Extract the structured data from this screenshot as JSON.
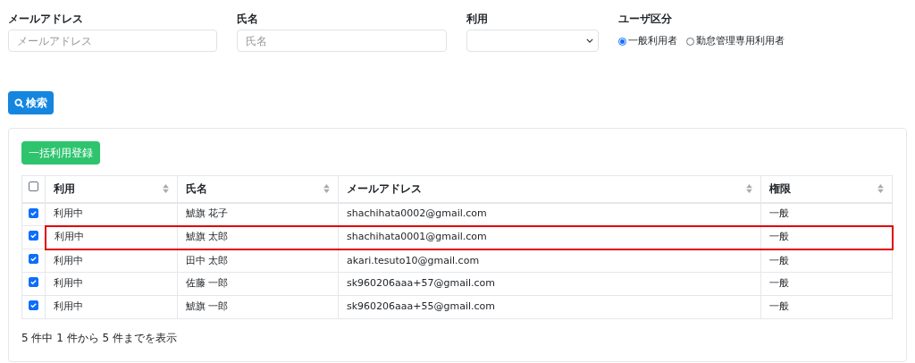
{
  "filters": {
    "email": {
      "label": "メールアドレス",
      "placeholder": "メールアドレス"
    },
    "name": {
      "label": "氏名",
      "placeholder": "氏名"
    },
    "usage": {
      "label": "利用"
    },
    "user_type": {
      "label": "ユーザ区分",
      "options": [
        {
          "label": "一般利用者",
          "selected": true
        },
        {
          "label": "勤怠管理専用利用者",
          "selected": false
        }
      ]
    }
  },
  "search_button": "検索",
  "bulk_button": "一括利用登録",
  "table": {
    "select_all": false,
    "columns": [
      "利用",
      "氏名",
      "メールアドレス",
      "権限"
    ],
    "rows": [
      {
        "checked": true,
        "highlighted": false,
        "cells": [
          "利用中",
          "鯱旗 花子",
          "shachihata0002@gmail.com",
          "一般"
        ]
      },
      {
        "checked": true,
        "highlighted": true,
        "cells": [
          "利用中",
          "鯱旗 太郎",
          "shachihata0001@gmail.com",
          "一般"
        ]
      },
      {
        "checked": true,
        "highlighted": false,
        "cells": [
          "利用中",
          "田中 太郎",
          "akari.tesuto10@gmail.com",
          "一般"
        ]
      },
      {
        "checked": true,
        "highlighted": false,
        "cells": [
          "利用中",
          "佐藤 一郎",
          "sk960206aaa+57@gmail.com",
          "一般"
        ]
      },
      {
        "checked": true,
        "highlighted": false,
        "cells": [
          "利用中",
          "鯱旗 一郎",
          "sk960206aaa+55@gmail.com",
          "一般"
        ]
      }
    ]
  },
  "footer": "5 件中 1 件から 5 件までを表示"
}
